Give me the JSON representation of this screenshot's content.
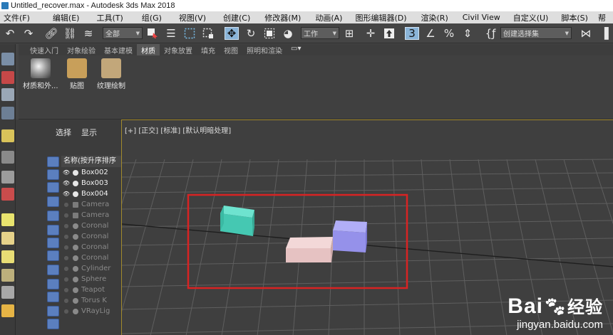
{
  "window": {
    "title": "Untitled_recover.max - Autodesk 3ds Max 2018"
  },
  "menu": [
    "文件(F)",
    "编辑(E)",
    "工具(T)",
    "组(G)",
    "视图(V)",
    "创建(C)",
    "修改器(M)",
    "动画(A)",
    "图形编辑器(D)",
    "渲染(R)",
    "Civil View",
    "自定义(U)",
    "脚本(S)",
    "帮"
  ],
  "toolbar": {
    "selection_filter": "全部",
    "coord_system": "工作",
    "named_selection": "创建选择集"
  },
  "ribbon": {
    "tabs": [
      "快速入门",
      "对象绘验",
      "基本建模",
      "材质",
      "对象放置",
      "填充",
      "视图",
      "照明和渲染"
    ],
    "active_tab": "材质",
    "buttons": [
      {
        "label": "材质和外..."
      },
      {
        "label": "贴图"
      },
      {
        "label": "纹理绘制"
      }
    ]
  },
  "scene_explorer": {
    "tabs": [
      "选择",
      "显示"
    ],
    "column_header": "名称(按升序排序",
    "rows": [
      {
        "name": "Box002",
        "visible": true
      },
      {
        "name": "Box003",
        "visible": true
      },
      {
        "name": "Box004",
        "visible": true
      },
      {
        "name": "Camera",
        "visible": false
      },
      {
        "name": "Camera",
        "visible": false
      },
      {
        "name": "Coronal",
        "visible": false
      },
      {
        "name": "Coronal",
        "visible": false
      },
      {
        "name": "Coronal",
        "visible": false
      },
      {
        "name": "Coronal",
        "visible": false
      },
      {
        "name": "Cylinder",
        "visible": false
      },
      {
        "name": "Sphere",
        "visible": false
      },
      {
        "name": "Teapot",
        "visible": false
      },
      {
        "name": "Torus K",
        "visible": false
      },
      {
        "name": "VRayLig",
        "visible": false
      }
    ]
  },
  "viewport": {
    "label": "[+] [正交] [标准] [默认明暗处理]",
    "objects": [
      {
        "name": "teal-box",
        "color": "#46cdb8"
      },
      {
        "name": "pink-box",
        "color": "#e9c6c6"
      },
      {
        "name": "lavender-box",
        "color": "#9c98f0"
      }
    ],
    "highlight_color": "#d82323"
  },
  "watermark": {
    "logo": "Bai",
    "logo_cn": "经验",
    "url": "jingyan.baidu.com"
  }
}
